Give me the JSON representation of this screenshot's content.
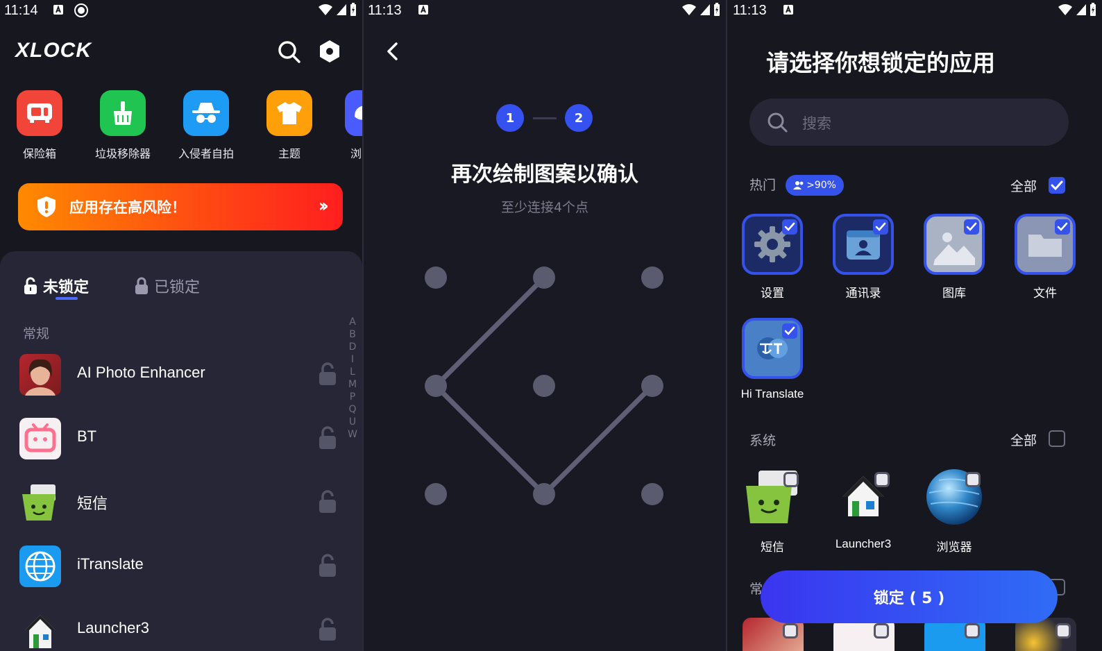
{
  "panel1": {
    "status": {
      "time": "11:14"
    },
    "logo": "XLOCK",
    "tools": [
      {
        "label": "保险箱",
        "color": "#f2453a",
        "icon": "safe-icon"
      },
      {
        "label": "垃圾移除器",
        "color": "#1fc451",
        "icon": "broom-icon"
      },
      {
        "label": "入侵者自拍",
        "color": "#1e9bf5",
        "icon": "spy-icon"
      },
      {
        "label": "主题",
        "color": "#ff9f0a",
        "icon": "shirt-icon"
      },
      {
        "label": "浏",
        "color": "#4b5cff",
        "icon": "browser-icon"
      }
    ],
    "risk_banner": {
      "text": "应用存在高风险！",
      "arrow": "››"
    },
    "tabs": {
      "unlocked": "未锁定",
      "locked": "已锁定"
    },
    "section": "常规",
    "alphabet": [
      "A",
      "B",
      "D",
      "I",
      "L",
      "M",
      "P",
      "Q",
      "U",
      "W"
    ],
    "apps": [
      {
        "name": "AI Photo Enhancer",
        "icon": "portrait-icon"
      },
      {
        "name": "BT",
        "icon": "bt-tv-icon"
      },
      {
        "name": "短信",
        "icon": "sms-icon"
      },
      {
        "name": "iTranslate",
        "icon": "globe-icon"
      },
      {
        "name": "Launcher3",
        "icon": "house-icon"
      }
    ]
  },
  "panel2": {
    "status": {
      "time": "11:13"
    },
    "steps": [
      "1",
      "2"
    ],
    "title": "再次绘制图案以确认",
    "subtitle": "至少连接4个点"
  },
  "panel3": {
    "status": {
      "time": "11:13"
    },
    "title": "请选择你想锁定的应用",
    "search_placeholder": "搜索",
    "hot": {
      "label": "热门",
      "badge": ">90%",
      "all_label": "全部",
      "all_checked": true
    },
    "hot_apps": [
      {
        "name": "设置",
        "icon": "gear-icon",
        "checked": true
      },
      {
        "name": "通讯录",
        "icon": "contacts-icon",
        "checked": true
      },
      {
        "name": "图库",
        "icon": "gallery-icon",
        "checked": true
      },
      {
        "name": "文件",
        "icon": "folder-icon",
        "checked": true
      },
      {
        "name": "Hi Translate",
        "icon": "translate-icon",
        "checked": true
      }
    ],
    "system": {
      "label": "系统",
      "all_label": "全部",
      "all_checked": false
    },
    "system_apps": [
      {
        "name": "短信",
        "icon": "sms-icon",
        "checked": false
      },
      {
        "name": "Launcher3",
        "icon": "house-icon",
        "checked": false
      },
      {
        "name": "浏览器",
        "icon": "planet-icon",
        "checked": false
      }
    ],
    "partial_section": "常",
    "lock_button": "锁定 ( 5 )",
    "accent": "#3553ea"
  }
}
